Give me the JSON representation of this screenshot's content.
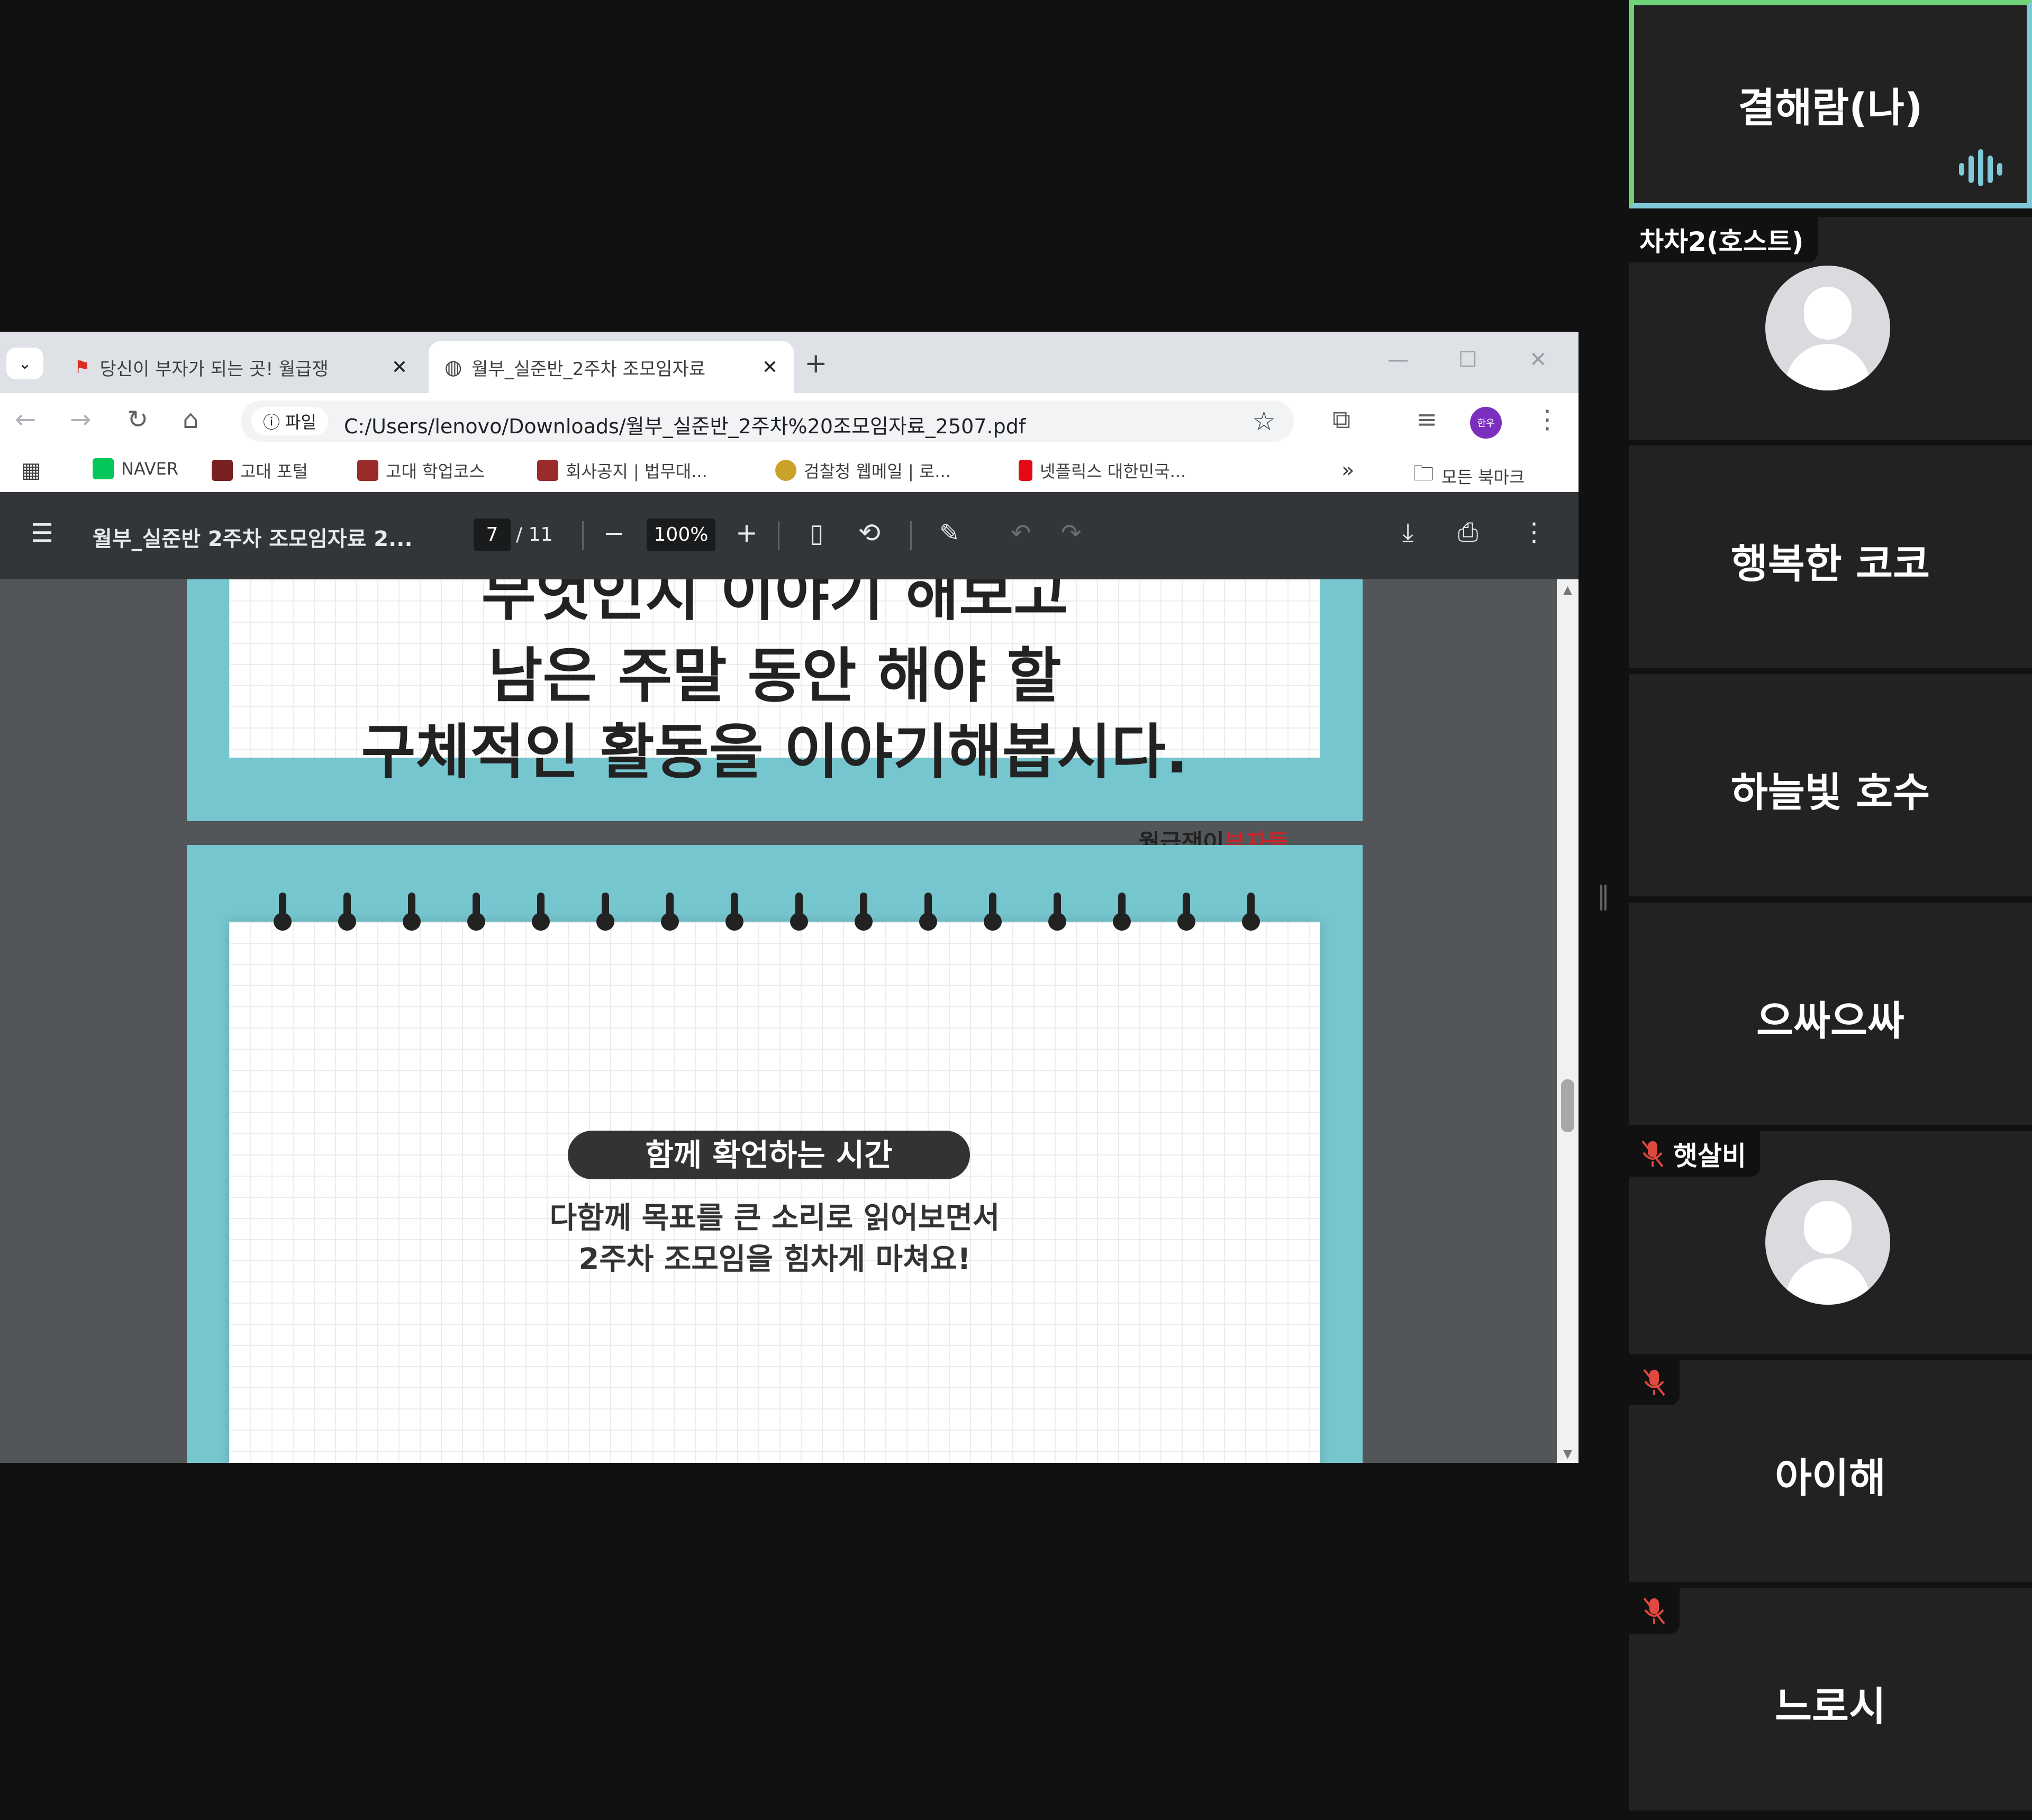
{
  "browser": {
    "tabs": [
      {
        "label": "당신이 부자가 되는 곳! 월급쟁",
        "active": false
      },
      {
        "label": "월부_실준반_2주차 조모임자료",
        "active": true
      }
    ],
    "omnibox": {
      "site_label": "파일",
      "url": "C:/Users/lenovo/Downloads/월부_실준반_2주차%20조모임자료_2507.pdf"
    },
    "profile_initial": "한우",
    "bookmarks": [
      {
        "label": "NAVER"
      },
      {
        "label": "고대 포털"
      },
      {
        "label": "고대 학업코스"
      },
      {
        "label": "회사공지 | 법무대..."
      },
      {
        "label": "검찰청 웹메일 | 로..."
      },
      {
        "label": "넷플릭스 대한민국..."
      },
      {
        "label": "모든 북마크"
      }
    ],
    "more_bookmarks": "»"
  },
  "pdf": {
    "title": "월부_실준반 2주차 조모임자료 2...",
    "page_current": "7",
    "page_total": "/ 11",
    "zoom": "100%",
    "slide1": {
      "line_cut": "무엇인지 이야기 해보고",
      "line2": "남은 주말 동안 해야 할",
      "line3": "구체적인 활동을 이야기해봅시다.",
      "brand_black": "월급쟁이",
      "brand_red": "부자들"
    },
    "slide2": {
      "pill": "함께 확언하는 시간",
      "line1": "다함께 목표를 큰 소리로 읽어보면서",
      "line2": "2주차 조모임을 힘차게 마쳐요!"
    }
  },
  "participants": [
    {
      "name": "결해람(나)",
      "speaking": true
    },
    {
      "tag": "차차2(호스트)"
    },
    {
      "name": "행복한 코코"
    },
    {
      "name": "하늘빛 호수"
    },
    {
      "name": "으싸으싸"
    },
    {
      "tag": "햇살비",
      "muted": true
    },
    {
      "name": "아이해",
      "muted": true
    },
    {
      "name": "느로시",
      "muted": true
    }
  ],
  "colors": {
    "speaking_border": "#6fd37a",
    "slide_teal": "#76c6cf",
    "brand_red": "#c8252c",
    "mute_red": "#e0493f"
  }
}
